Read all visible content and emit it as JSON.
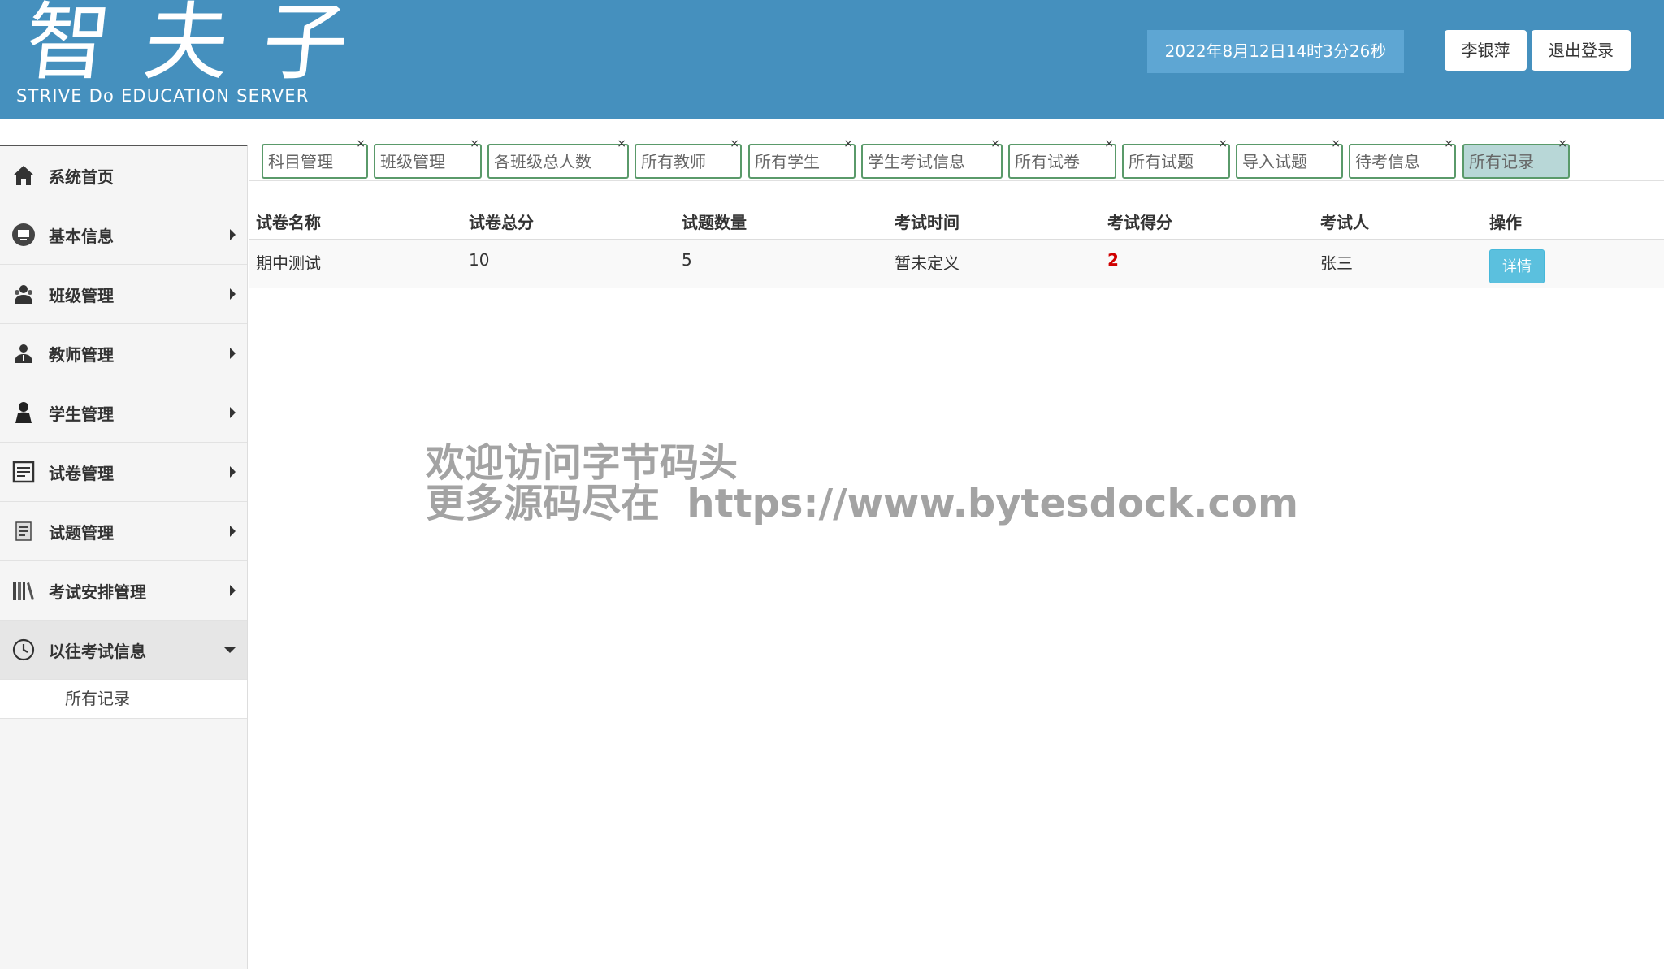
{
  "header": {
    "logo_cn": "智夫子",
    "logo_en": "STRIVE Do EDUCATION SERVER",
    "datetime": "2022年8月12日14时3分26秒",
    "user_name": "李银萍",
    "logout_label": "退出登录",
    "bg_color": "#4590be"
  },
  "sidebar": {
    "items": [
      {
        "label": "系统首页",
        "icon": "home-icon"
      },
      {
        "label": "基本信息",
        "icon": "monitor-icon"
      },
      {
        "label": "班级管理",
        "icon": "users-icon"
      },
      {
        "label": "教师管理",
        "icon": "teacher-icon"
      },
      {
        "label": "学生管理",
        "icon": "user-icon"
      },
      {
        "label": "试卷管理",
        "icon": "document-icon"
      },
      {
        "label": "试题管理",
        "icon": "scroll-icon"
      },
      {
        "label": "考试安排管理",
        "icon": "books-icon"
      },
      {
        "label": "以往考试信息",
        "icon": "clock-icon"
      }
    ],
    "sub_items": [
      {
        "label": "所有记录"
      }
    ]
  },
  "tabs": [
    {
      "label": "科目管理"
    },
    {
      "label": "班级管理"
    },
    {
      "label": "各班级总人数"
    },
    {
      "label": "所有教师"
    },
    {
      "label": "所有学生"
    },
    {
      "label": "学生考试信息"
    },
    {
      "label": "所有试卷"
    },
    {
      "label": "所有试题"
    },
    {
      "label": "导入试题"
    },
    {
      "label": "待考信息"
    },
    {
      "label": "所有记录"
    }
  ],
  "table": {
    "columns": [
      "试卷名称",
      "试卷总分",
      "试题数量",
      "考试时间",
      "考试得分",
      "考试人",
      "操作"
    ],
    "rows": [
      {
        "name": "期中测试",
        "total": "10",
        "count": "5",
        "time": "暂未定义",
        "score": "2",
        "examinee": "张三",
        "action": "详情"
      }
    ]
  },
  "watermark": {
    "line1": "欢迎访问字节码头",
    "line2": "更多源码尽在  https://www.bytesdock.com"
  }
}
